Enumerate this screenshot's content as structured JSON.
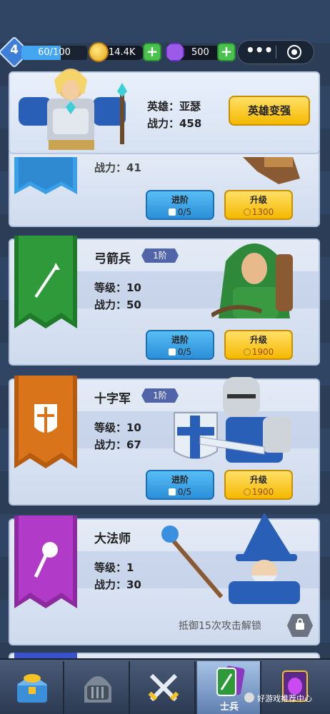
{
  "topbar": {
    "level": "4",
    "xp_text": "60/100",
    "xp_progress": 0.6,
    "coins": "14.4K",
    "gems": "500"
  },
  "hero": {
    "name_label": "英雄：亚瑟",
    "power_label": "战力：458",
    "strengthen_button": "英雄变强"
  },
  "units": [
    {
      "name": "",
      "level_label": "",
      "power_label": "战力：41",
      "advance_label": "进阶",
      "advance_progress": "0/5",
      "upgrade_label": "升级",
      "upgrade_cost": "1300",
      "banner_color": "#3aa0e8"
    },
    {
      "name": "弓箭兵",
      "tier": "1阶",
      "level_label": "等级：10",
      "power_label": "战力：50",
      "advance_label": "进阶",
      "advance_progress": "0/5",
      "upgrade_label": "升级",
      "upgrade_cost": "1900",
      "banner_color": "#2e9a3a",
      "icon": "arrow-icon"
    },
    {
      "name": "十字军",
      "tier": "1阶",
      "level_label": "等级：10",
      "power_label": "战力：67",
      "advance_label": "进阶",
      "advance_progress": "0/5",
      "upgrade_label": "升级",
      "upgrade_cost": "1900",
      "banner_color": "#d9741a",
      "icon": "shield-cross-icon"
    },
    {
      "name": "大法师",
      "level_label": "等级：1",
      "power_label": "战力：30",
      "lock_text": "抵御15次攻击解锁",
      "banner_color": "#b23ac8",
      "icon": "staff-orb-icon"
    }
  ],
  "nav": {
    "tabs": [
      {
        "icon": "treasure-chest-icon",
        "label": ""
      },
      {
        "icon": "knight-helmet-icon",
        "label": ""
      },
      {
        "icon": "crossed-swords-icon",
        "label": ""
      },
      {
        "icon": "soldier-cards-icon",
        "label": "士兵",
        "active": true
      },
      {
        "icon": "spell-card-icon",
        "label": ""
      }
    ]
  },
  "watermark": "好游戏推荐中心"
}
